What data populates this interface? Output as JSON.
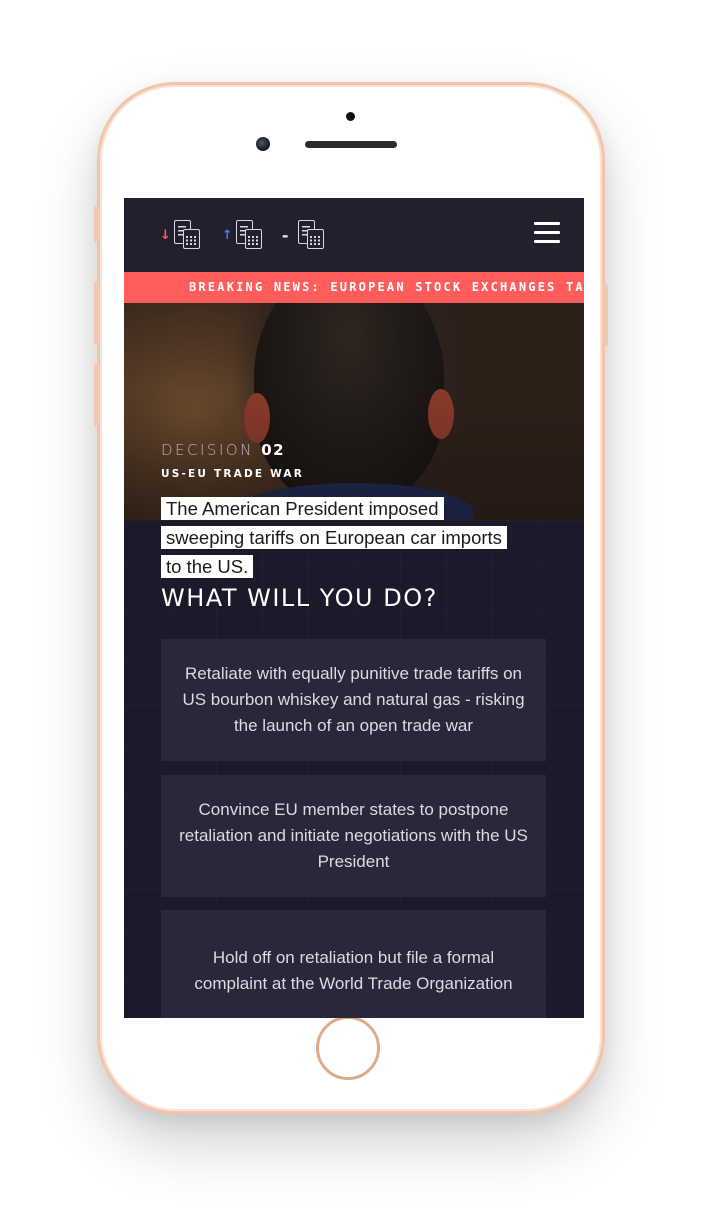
{
  "header": {
    "indicators": [
      {
        "arrow": "↓",
        "direction": "down",
        "color": "#ff5b5b",
        "icon": "calculator-document-icon"
      },
      {
        "arrow": "↑",
        "direction": "up",
        "color": "#3b7bff",
        "icon": "calculator-document-icon"
      },
      {
        "arrow": "-",
        "direction": "neutral",
        "color": "#e8e8ee",
        "icon": "calculator-document-icon"
      }
    ],
    "menu_icon": "hamburger-menu-icon"
  },
  "ticker": {
    "text": "BREAKING NEWS: EUROPEAN STOCK EXCHANGES TANK",
    "color": "#ff5c5c"
  },
  "decision": {
    "label": "DECISION",
    "number": "02",
    "topic": "US-EU TRADE WAR",
    "headline": "The American President imposed sweeping tariffs on European car imports to the US."
  },
  "question": "WHAT WILL YOU DO?",
  "options": [
    {
      "label": "Retaliate with equally punitive trade tariffs on US bourbon whiskey and natural gas - risking the launch of an open trade war"
    },
    {
      "label": "Convince EU member states to postpone retaliation and initiate negotiations with the US President"
    },
    {
      "label": "Hold off on retaliation but file a formal complaint at the World Trade Organization"
    }
  ],
  "colors": {
    "background": "#1c1a2a",
    "option_background": "#2a2738",
    "accent": "#ff5c5c"
  }
}
